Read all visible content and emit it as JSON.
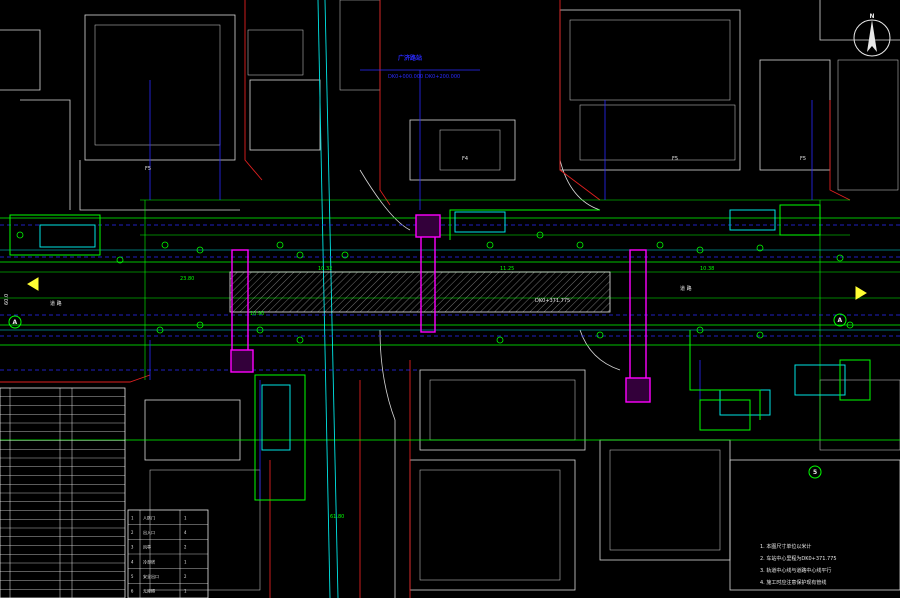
{
  "compass": {
    "north_label": "N"
  },
  "labels": {
    "top_blue_1": "广济路站",
    "top_blue_2": "DK0+000.000",
    "top_blue_3": "DK0+200.000",
    "building_f5_a": "F5",
    "building_f4": "F4",
    "building_f5_b": "F5",
    "building_f5_c": "F5",
    "station_center": "DK0+371.775",
    "left_axis_num": "60.0",
    "left_axis_a": "A",
    "right_axis_a": "A",
    "bottom_axis_5": "5",
    "dim_top_1": "10.32",
    "dim_top_2": "11.25",
    "dim_top_3": "10.38",
    "dim_mid_1": "23.80",
    "dim_mid_2": "10.90",
    "dim_bottom": "61.80",
    "road_label_left": "道 路",
    "road_label_right": "道 路"
  },
  "legend": {
    "rows": [
      [
        "1",
        "人防门",
        "1"
      ],
      [
        "2",
        "出入口",
        "4"
      ],
      [
        "3",
        "风亭",
        "2"
      ],
      [
        "4",
        "冷却塔",
        "1"
      ],
      [
        "5",
        "安全出口",
        "2"
      ],
      [
        "6",
        "无障碍",
        "1"
      ]
    ]
  },
  "left_table_row_count": 24,
  "notes": {
    "line1": "1. 本图尺寸单位以米计",
    "line2": "2. 车站中心里程为DK0+371.775",
    "line3": "3. 轨道中心线与道路中心线平行",
    "line4": "4. 施工时应注意保护现有管线"
  },
  "colors": {
    "background": "#000000",
    "white": "#e8e8e8",
    "green": "#00ff00",
    "blue": "#2a2aff",
    "cyan": "#00e5e5",
    "magenta": "#ff00ff",
    "red": "#e02020",
    "yellow": "#ffff33"
  }
}
